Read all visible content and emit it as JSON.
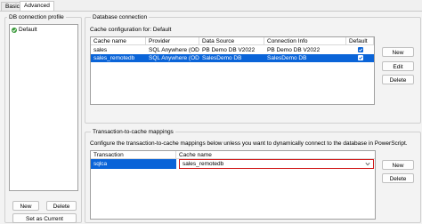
{
  "tabs": [
    "Basic",
    "Advanced"
  ],
  "profile": {
    "title": "DB connection profile",
    "items": [
      {
        "label": "Default"
      }
    ],
    "new_label": "New",
    "delete_label": "Delete",
    "set_current_label": "Set as Current"
  },
  "db": {
    "title": "Database connection",
    "config_label": "Cache configuration for: Default",
    "columns": [
      "Cache name",
      "Provider",
      "Data Source",
      "Connection Info",
      "Default"
    ],
    "rows": [
      {
        "cache": "sales",
        "provider": "SQL Anywhere (ODBC)",
        "source": "PB Demo DB V2022",
        "info": "PB Demo DB V2022",
        "default": true
      },
      {
        "cache": "sales_remotedb",
        "provider": "SQL Anywhere (ODBC)",
        "source": "SalesDemo DB",
        "info": "SalesDemo DB",
        "default": true
      }
    ],
    "new_label": "New",
    "edit_label": "Edit",
    "delete_label": "Delete"
  },
  "mapping": {
    "title": "Transaction-to-cache mappings",
    "description": "Configure the transaction-to-cache mappings below unless you want to dynamically connect to the database in PowerScript.",
    "columns": [
      "Transaction",
      "Cache name"
    ],
    "rows": [
      {
        "transaction": "sqlca",
        "cache": "sales_remotedb"
      }
    ],
    "new_label": "New",
    "delete_label": "Delete"
  },
  "colors": {
    "selection": "#0a64d8",
    "highlight_border": "#d01818",
    "accent": "#3a9a3a"
  }
}
